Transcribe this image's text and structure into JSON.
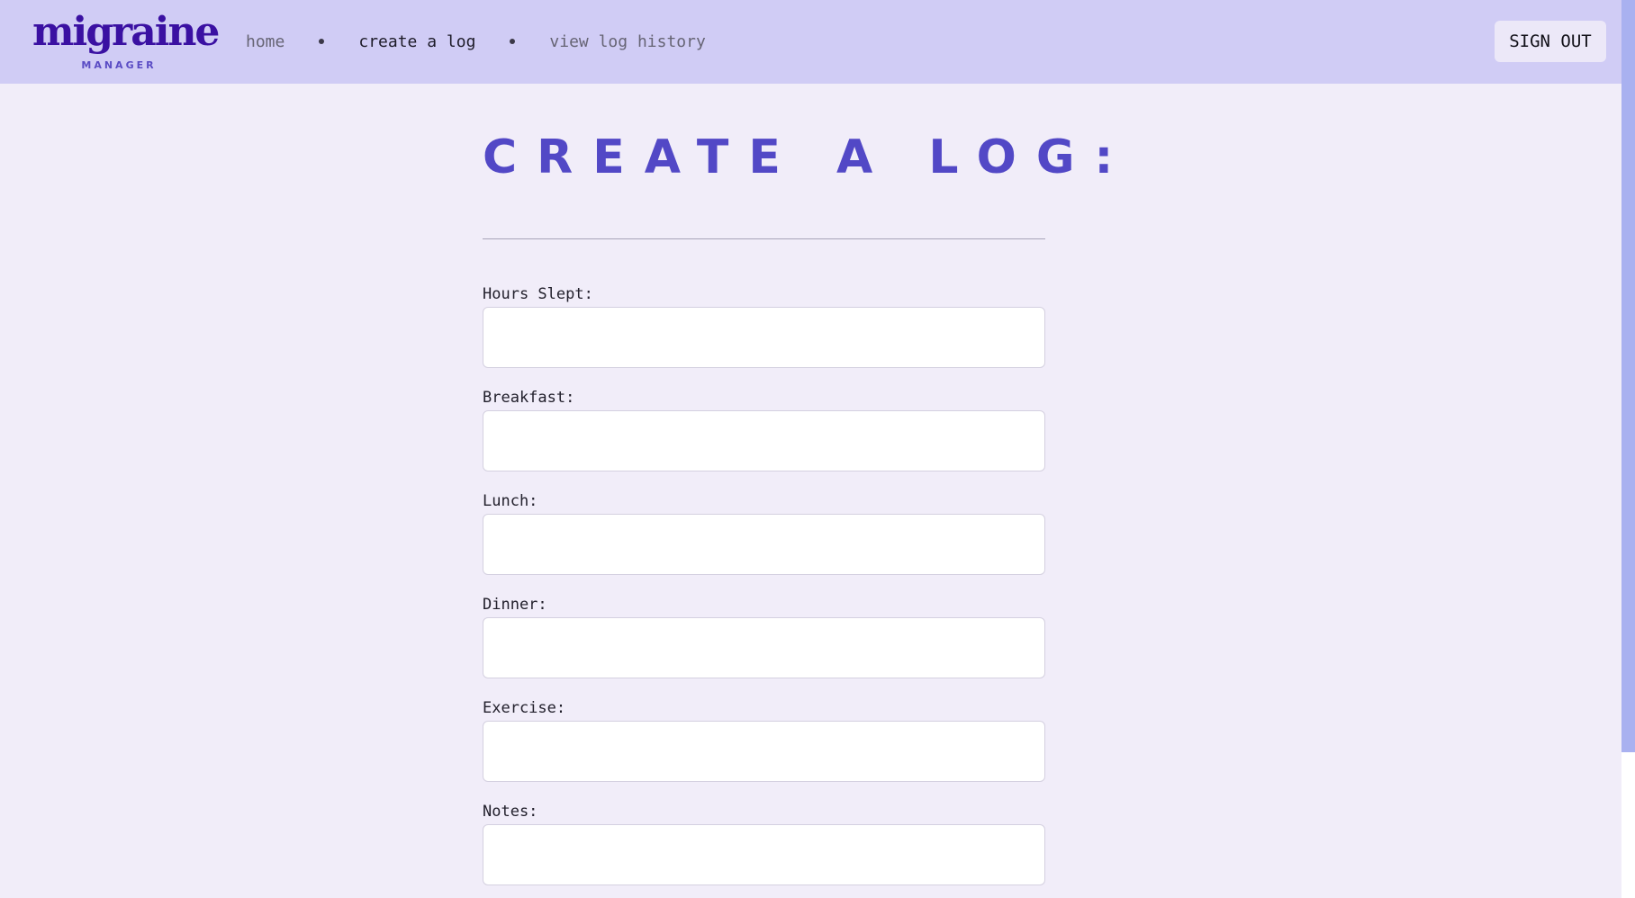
{
  "app": {
    "logo_text": "migraine",
    "logo_subtext": "MANAGER"
  },
  "nav": {
    "items": [
      {
        "label": "home",
        "active": false
      },
      {
        "label": "create a log",
        "active": true
      },
      {
        "label": "view log history",
        "active": false
      }
    ],
    "signout_label": "SIGN OUT"
  },
  "page": {
    "title": "CREATE A LOG:"
  },
  "form": {
    "fields": [
      {
        "label": "Hours Slept:",
        "value": ""
      },
      {
        "label": "Breakfast:",
        "value": ""
      },
      {
        "label": "Lunch:",
        "value": ""
      },
      {
        "label": "Dinner:",
        "value": ""
      },
      {
        "label": "Exercise:",
        "value": ""
      },
      {
        "label": "Notes:",
        "value": ""
      }
    ]
  },
  "colors": {
    "header_bg": "#d0ccf5",
    "page_bg": "#f1edf9",
    "accent": "#5248c6",
    "logo": "#3a10a2",
    "scroll_thumb": "#a9b1f0"
  }
}
